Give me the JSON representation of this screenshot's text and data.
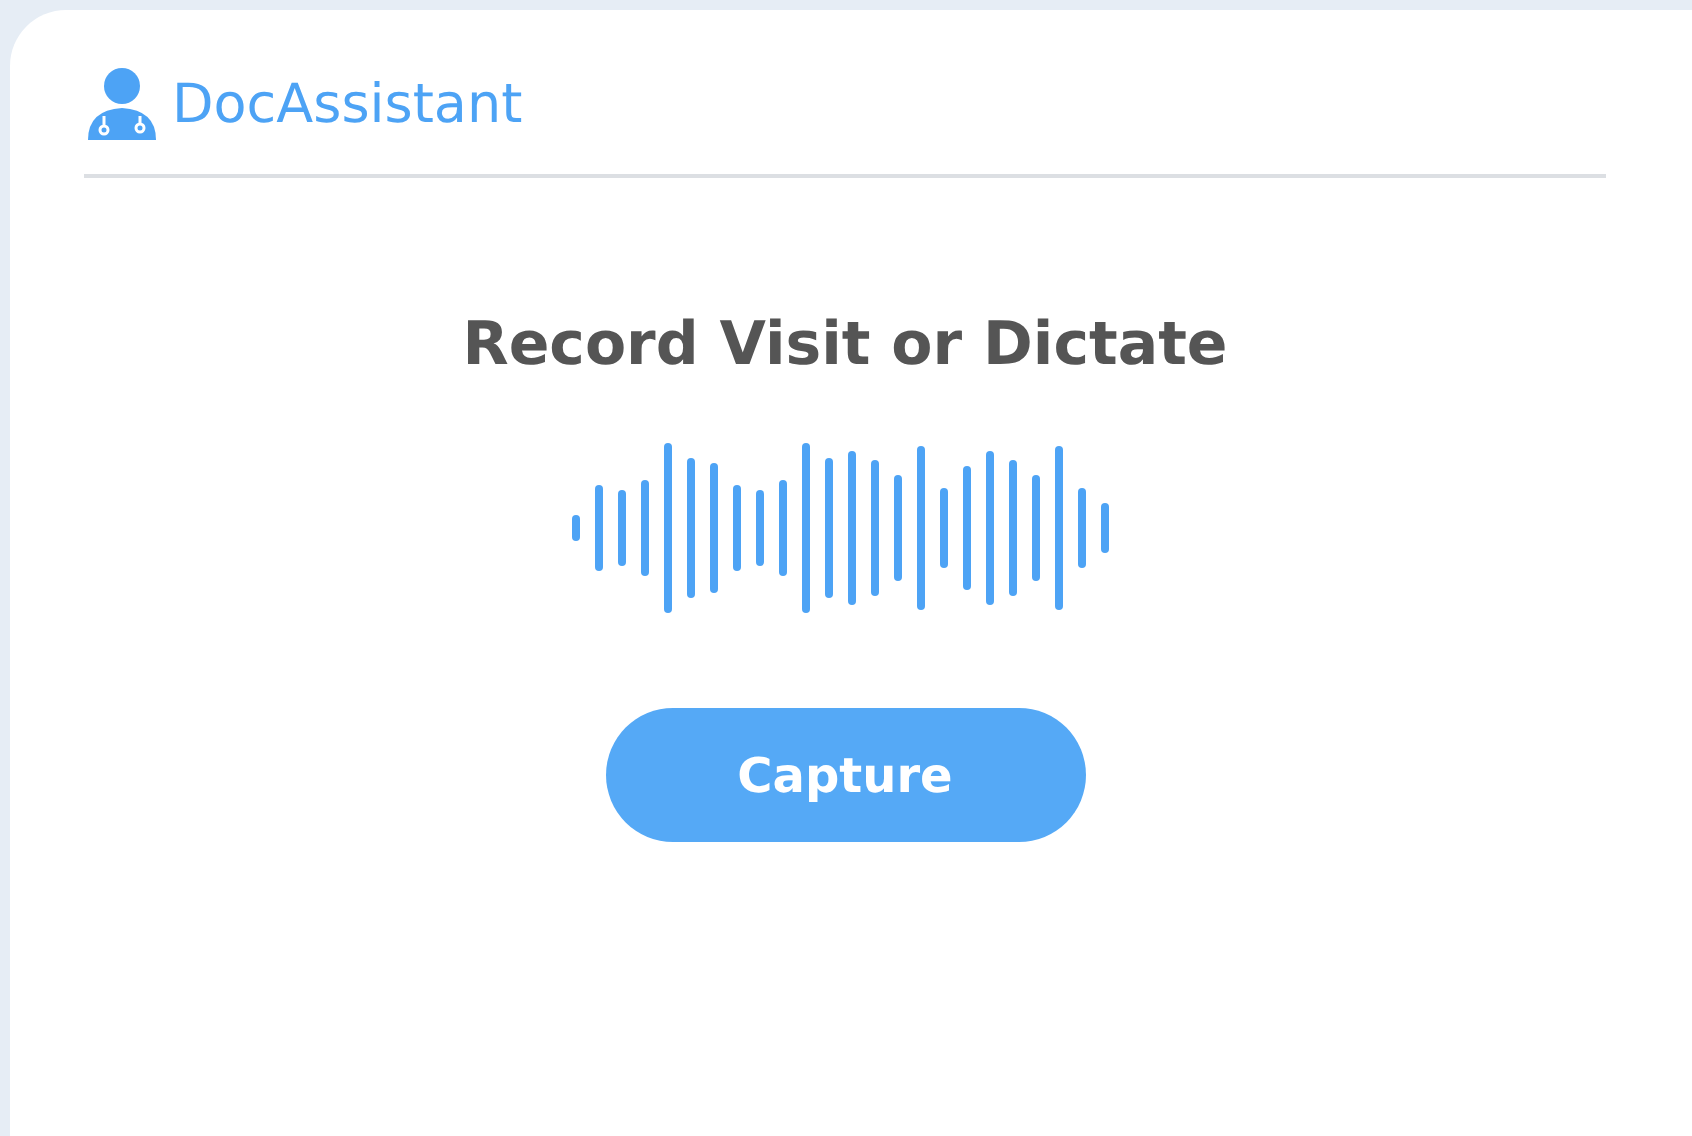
{
  "app": {
    "name": "DocAssistant"
  },
  "main": {
    "heading": "Record Visit or Dictate",
    "button": "Capture"
  }
}
